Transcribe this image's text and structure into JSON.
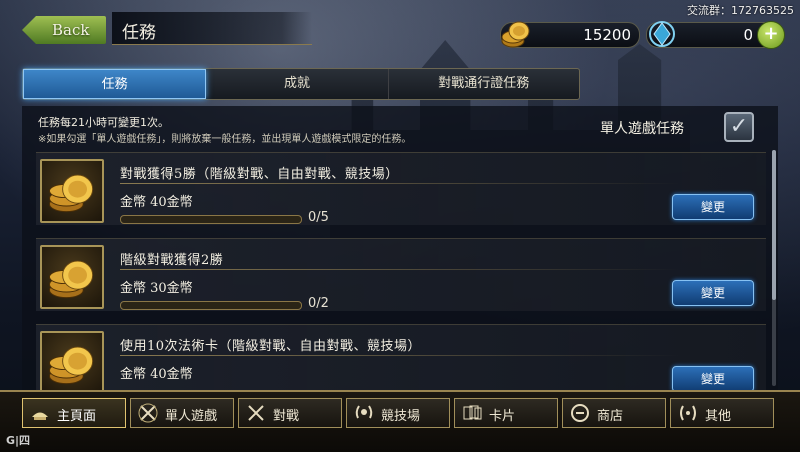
{
  "header": {
    "back_label": "Back",
    "title": "任務",
    "watermark": "交流群：172763525",
    "gold": "15200",
    "crystals": "0"
  },
  "tabs": [
    {
      "label": "任務"
    },
    {
      "label": "成就"
    },
    {
      "label": "對戰通行證任務"
    }
  ],
  "notes": {
    "line1": "任務每21小時可變更1次。",
    "line2": "※如果勾選「單人遊戲任務」，則將放棄一般任務，並出現單人遊戲模式限定的任務。"
  },
  "solo_option": {
    "label": "單人遊戲任務",
    "checked": true
  },
  "missions": [
    {
      "name": "對戰獲得5勝（階級對戰、自由對戰、競技場）",
      "reward": "金幣 40金幣",
      "progress": "0/5",
      "change_label": "變更"
    },
    {
      "name": "階級對戰獲得2勝",
      "reward": "金幣 30金幣",
      "progress": "0/2",
      "change_label": "變更"
    },
    {
      "name": "使用10次法術卡（階級對戰、自由對戰、競技場）",
      "reward": "金幣 40金幣",
      "progress": "",
      "change_label": "變更"
    }
  ],
  "nav": [
    {
      "label": "主頁面",
      "icon": "home-icon"
    },
    {
      "label": "單人遊戲",
      "icon": "crossed-swords-single-icon"
    },
    {
      "label": "對戰",
      "icon": "crossed-swords-icon"
    },
    {
      "label": "競技場",
      "icon": "laurel-icon"
    },
    {
      "label": "卡片",
      "icon": "cards-icon"
    },
    {
      "label": "商店",
      "icon": "shop-icon"
    },
    {
      "label": "其他",
      "icon": "other-icon"
    }
  ],
  "corner_logo": "G|四"
}
